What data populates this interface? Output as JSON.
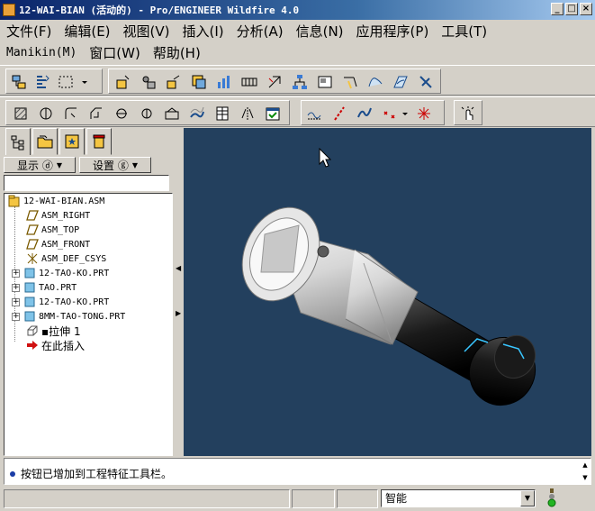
{
  "window": {
    "title": "12-WAI-BIAN (活动的) - Pro/ENGINEER Wildfire 4.0"
  },
  "menu_row1": [
    "文件(F)",
    "编辑(E)",
    "视图(V)",
    "插入(I)",
    "分析(A)",
    "信息(N)",
    "应用程序(P)",
    "工具(T)"
  ],
  "menu_row2": [
    "Manikin(M)",
    "窗口(W)",
    "帮助(H)"
  ],
  "panel": {
    "show_label": "显示 ⓓ",
    "settings_label": "设置 ⓖ"
  },
  "tree": {
    "items": [
      {
        "label": "12-WAI-BIAN.ASM",
        "icon": "assembly-icon"
      },
      {
        "label": "ASM_RIGHT",
        "icon": "datum-plane-icon"
      },
      {
        "label": "ASM_TOP",
        "icon": "datum-plane-icon"
      },
      {
        "label": "ASM_FRONT",
        "icon": "datum-plane-icon"
      },
      {
        "label": "ASM_DEF_CSYS",
        "icon": "csys-icon"
      },
      {
        "label": "12-TAO-KO.PRT",
        "icon": "part-icon"
      },
      {
        "label": "TAO.PRT",
        "icon": "part-icon"
      },
      {
        "label": "12-TAO-KO.PRT",
        "icon": "part-icon"
      },
      {
        "label": "8MM-TAO-TONG.PRT",
        "icon": "part-icon"
      },
      {
        "label": "▪拉伸 1",
        "icon": "extrude-icon"
      },
      {
        "label": "在此插入",
        "icon": "insert-here-icon"
      }
    ]
  },
  "message": {
    "text": "按钮已增加到工程特征工具栏。"
  },
  "status": {
    "filter_value": "智能"
  },
  "colors": {
    "graphics_bg": "#23405e",
    "titlebar": "#0a246a"
  }
}
